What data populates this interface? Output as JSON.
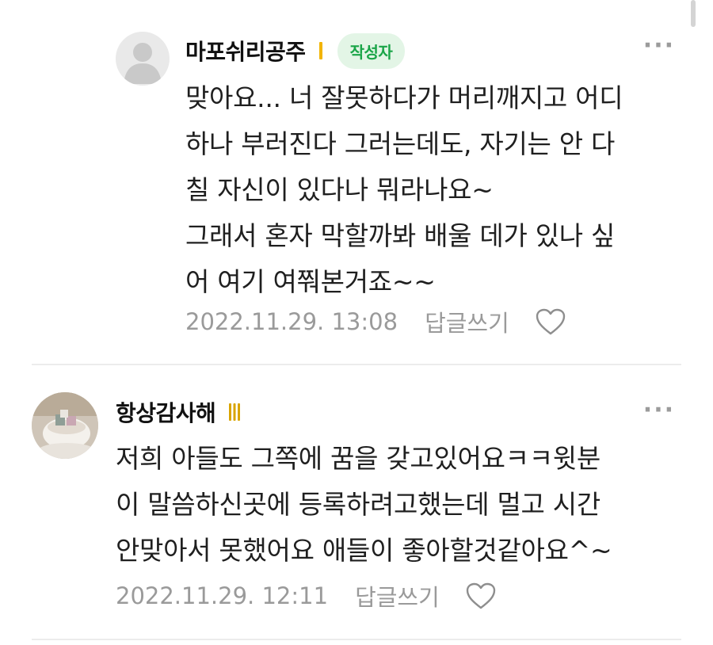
{
  "comments": [
    {
      "author": "마포쉬리공주",
      "badge": "작성자",
      "lines": [
        "맞아요... 너 잘못하다가 머리깨지고 어디",
        "하나 부러진다 그러는데도, 자기는 안 다",
        "칠 자신이 있다나 뭐라나요~",
        "그래서 혼자 막할까봐 배울 데가 있나 싶",
        "어 여기 여쭤본거죠~~"
      ],
      "date": "2022.11.29. 13:08",
      "reply": "답글쓰기",
      "more": "···"
    },
    {
      "author": "항상감사해",
      "lines": [
        "저희 아들도 그쪽에 꿈을 갖고있어요ㅋㅋ윗분",
        "이 말씀하신곳에 등록하려고했는데 멀고 시간",
        "안맞아서 못했어요 애들이 좋아할것같아요^~"
      ],
      "date": "2022.11.29. 12:11",
      "reply": "답글쓰기",
      "more": "···"
    }
  ],
  "colors": {
    "badge_bg": "#e3f5e6",
    "badge_text": "#1aa548",
    "level1": "#f2b400",
    "meta_gray": "#9a9a9a"
  }
}
